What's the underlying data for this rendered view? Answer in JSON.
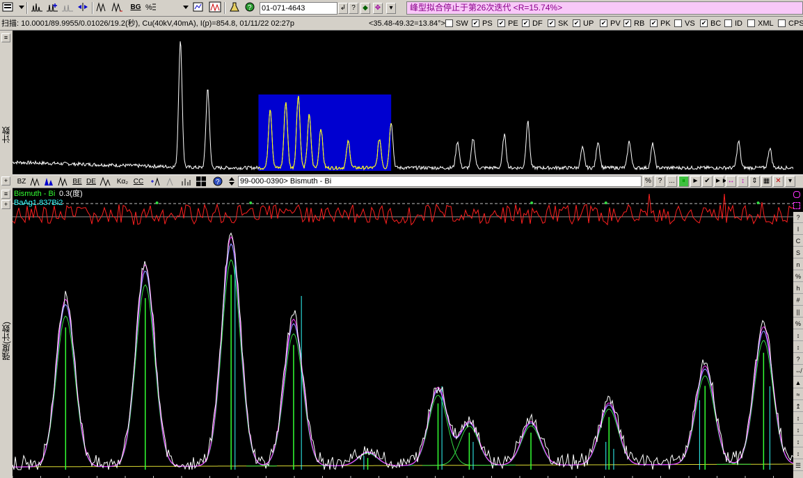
{
  "toolbar": {
    "icons": [
      "ribbon-icon",
      "menu-dropdown-icon",
      "peak-chart-icon",
      "peak-plus-icon",
      "peak-ghost-icon",
      "zoom-arrows-icon",
      "peaks-a-icon",
      "peaks-b-icon",
      "bg-icon",
      "percent-icon",
      "dropdown-icon",
      "report-icon",
      "xray-tube-icon",
      "flask-icon",
      "help-icon"
    ],
    "bg_label": "BG",
    "pdf_number": "01-071-4643",
    "pdf_buttons": [
      "↲",
      "?",
      "◆",
      "✥",
      "▾"
    ],
    "fit_status": "峰型拟合停止于第26次迭代 <R=15.74%>"
  },
  "status": {
    "scan_info": "扫描: 10.0001/89.9955/0.01026/19.2(秒), Cu(40kV,40mA), I(p)=854.8, 01/11/22 02:27p",
    "range_info": "<35.48-49.32=13.84°>",
    "toggles": [
      {
        "label": "SW",
        "checked": false
      },
      {
        "label": "PS",
        "checked": true
      },
      {
        "label": "PE",
        "checked": true
      },
      {
        "label": "DF",
        "checked": true
      },
      {
        "label": "SK",
        "checked": true
      },
      {
        "label": "UP",
        "checked": true
      },
      {
        "label": "PV",
        "checked": true
      },
      {
        "label": "RB",
        "checked": true
      },
      {
        "label": "PK",
        "checked": true
      },
      {
        "label": "VS",
        "checked": false
      },
      {
        "label": "BC",
        "checked": true
      },
      {
        "label": "ID",
        "checked": false
      },
      {
        "label": "XML",
        "checked": false
      },
      {
        "label": "CPS",
        "checked": false
      }
    ]
  },
  "overview": {
    "ylabel": "计数",
    "selection_color": "#0000d0"
  },
  "fit_toolbar": {
    "labels": [
      "BZ",
      "",
      "",
      "BE",
      "DE",
      "",
      "Kα₂",
      "CC",
      "",
      "",
      "",
      "",
      "?"
    ],
    "phase_entry": "99-000-0390> Bismuth - Bi",
    "right_buttons": [
      "%",
      "?",
      "...",
      "⏸",
      "►",
      "✔",
      "►►",
      "↔",
      "↕",
      "⇕",
      "▦",
      "✕",
      "▾"
    ]
  },
  "main": {
    "ylabel": "强度(计数)",
    "legend": [
      {
        "text": "Bismuth - Bi",
        "color": "#33ff33"
      },
      {
        "text": "0.3(度)",
        "color": "#ffffff"
      },
      {
        "text": "BaAg1.837Bi2",
        "color": "#33ffff"
      }
    ]
  },
  "right_strip": [
    "?",
    "I",
    "C",
    "S",
    "n",
    "%",
    "h",
    "#",
    "||",
    "%",
    "↕",
    "↕",
    "?",
    "⇎",
    "▲",
    "≈",
    "↥",
    "↕",
    "↕",
    "↕",
    "↕",
    "☰"
  ],
  "colors": {
    "observed": "#ffffff",
    "calculated": "#ff33ff",
    "profile": "#8888ff",
    "component": "#33dd44",
    "difference": "#ff2020",
    "bismuth_sticks": "#33ff33",
    "baagbi_sticks": "#33ffff",
    "background": "#dddd33"
  },
  "chart_data": {
    "type": "line",
    "view_range_deg": [
      35.48,
      49.32
    ],
    "view_width_deg": 13.84,
    "fitted_peaks": [
      {
        "pos": 0.068,
        "height": 0.73
      },
      {
        "pos": 0.17,
        "height": 0.88
      },
      {
        "pos": 0.28,
        "height": 1.0
      },
      {
        "pos": 0.36,
        "height": 0.64
      },
      {
        "pos": 0.455,
        "height": 0.06
      },
      {
        "pos": 0.545,
        "height": 0.34
      },
      {
        "pos": 0.585,
        "height": 0.19
      },
      {
        "pos": 0.664,
        "height": 0.19
      },
      {
        "pos": 0.764,
        "height": 0.27
      },
      {
        "pos": 0.887,
        "height": 0.43
      },
      {
        "pos": 0.962,
        "height": 0.6
      }
    ],
    "bismuth_stick_positions": [
      0.068,
      0.17,
      0.28,
      0.36,
      0.455,
      0.545,
      0.585,
      0.664,
      0.764,
      0.887,
      0.962
    ],
    "baagbi_stick_positions": [
      0.285,
      0.37,
      0.45,
      0.55,
      0.59,
      0.76,
      0.77,
      0.88,
      0.97
    ],
    "overview_peaks": [
      {
        "pos": 0.215,
        "height": 0.95
      },
      {
        "pos": 0.25,
        "height": 0.6
      },
      {
        "pos": 0.33,
        "height": 0.45
      },
      {
        "pos": 0.35,
        "height": 0.5
      },
      {
        "pos": 0.366,
        "height": 0.55
      },
      {
        "pos": 0.38,
        "height": 0.4
      },
      {
        "pos": 0.395,
        "height": 0.3
      },
      {
        "pos": 0.43,
        "height": 0.2
      },
      {
        "pos": 0.47,
        "height": 0.22
      },
      {
        "pos": 0.485,
        "height": 0.35
      },
      {
        "pos": 0.57,
        "height": 0.2
      },
      {
        "pos": 0.59,
        "height": 0.22
      },
      {
        "pos": 0.63,
        "height": 0.25
      },
      {
        "pos": 0.66,
        "height": 0.35
      },
      {
        "pos": 0.73,
        "height": 0.15
      },
      {
        "pos": 0.75,
        "height": 0.2
      },
      {
        "pos": 0.79,
        "height": 0.2
      },
      {
        "pos": 0.82,
        "height": 0.18
      },
      {
        "pos": 0.93,
        "height": 0.2
      },
      {
        "pos": 0.97,
        "height": 0.15
      }
    ],
    "selection_range": [
      0.315,
      0.485
    ],
    "xlabel": "",
    "ylabel": "强度(计数)"
  }
}
